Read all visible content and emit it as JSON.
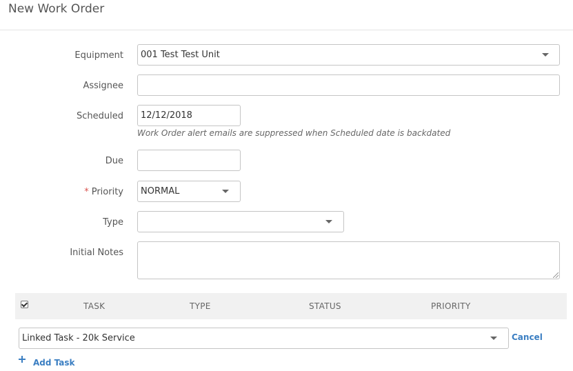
{
  "page": {
    "title": "New Work Order"
  },
  "form": {
    "equipment": {
      "label": "Equipment",
      "value": "001 Test Test Unit"
    },
    "assignee": {
      "label": "Assignee",
      "value": ""
    },
    "scheduled": {
      "label": "Scheduled",
      "value": "12/12/2018",
      "hint": "Work Order alert emails are suppressed when Scheduled date is backdated"
    },
    "due": {
      "label": "Due",
      "value": ""
    },
    "priority": {
      "label": "Priority",
      "required_mark": "*",
      "value": "NORMAL"
    },
    "type": {
      "label": "Type",
      "value": ""
    },
    "initial_notes": {
      "label": "Initial Notes",
      "value": ""
    }
  },
  "tasks": {
    "columns": [
      "TASK",
      "TYPE",
      "STATUS",
      "PRIORITY"
    ],
    "header_checkbox_checked": true,
    "new_task": {
      "value": "Linked Task - 20k Service",
      "cancel_label": "Cancel"
    },
    "add_task_label": "Add Task"
  },
  "icons": [
    "chevron-down-icon",
    "checkbox-icon",
    "plus-icon",
    "resize-handle-icon"
  ],
  "colors": {
    "link": "#3a7ec2",
    "required": "#d9534f",
    "table_header_bg": "#f1f1f1",
    "border": "#c4c4c4"
  }
}
